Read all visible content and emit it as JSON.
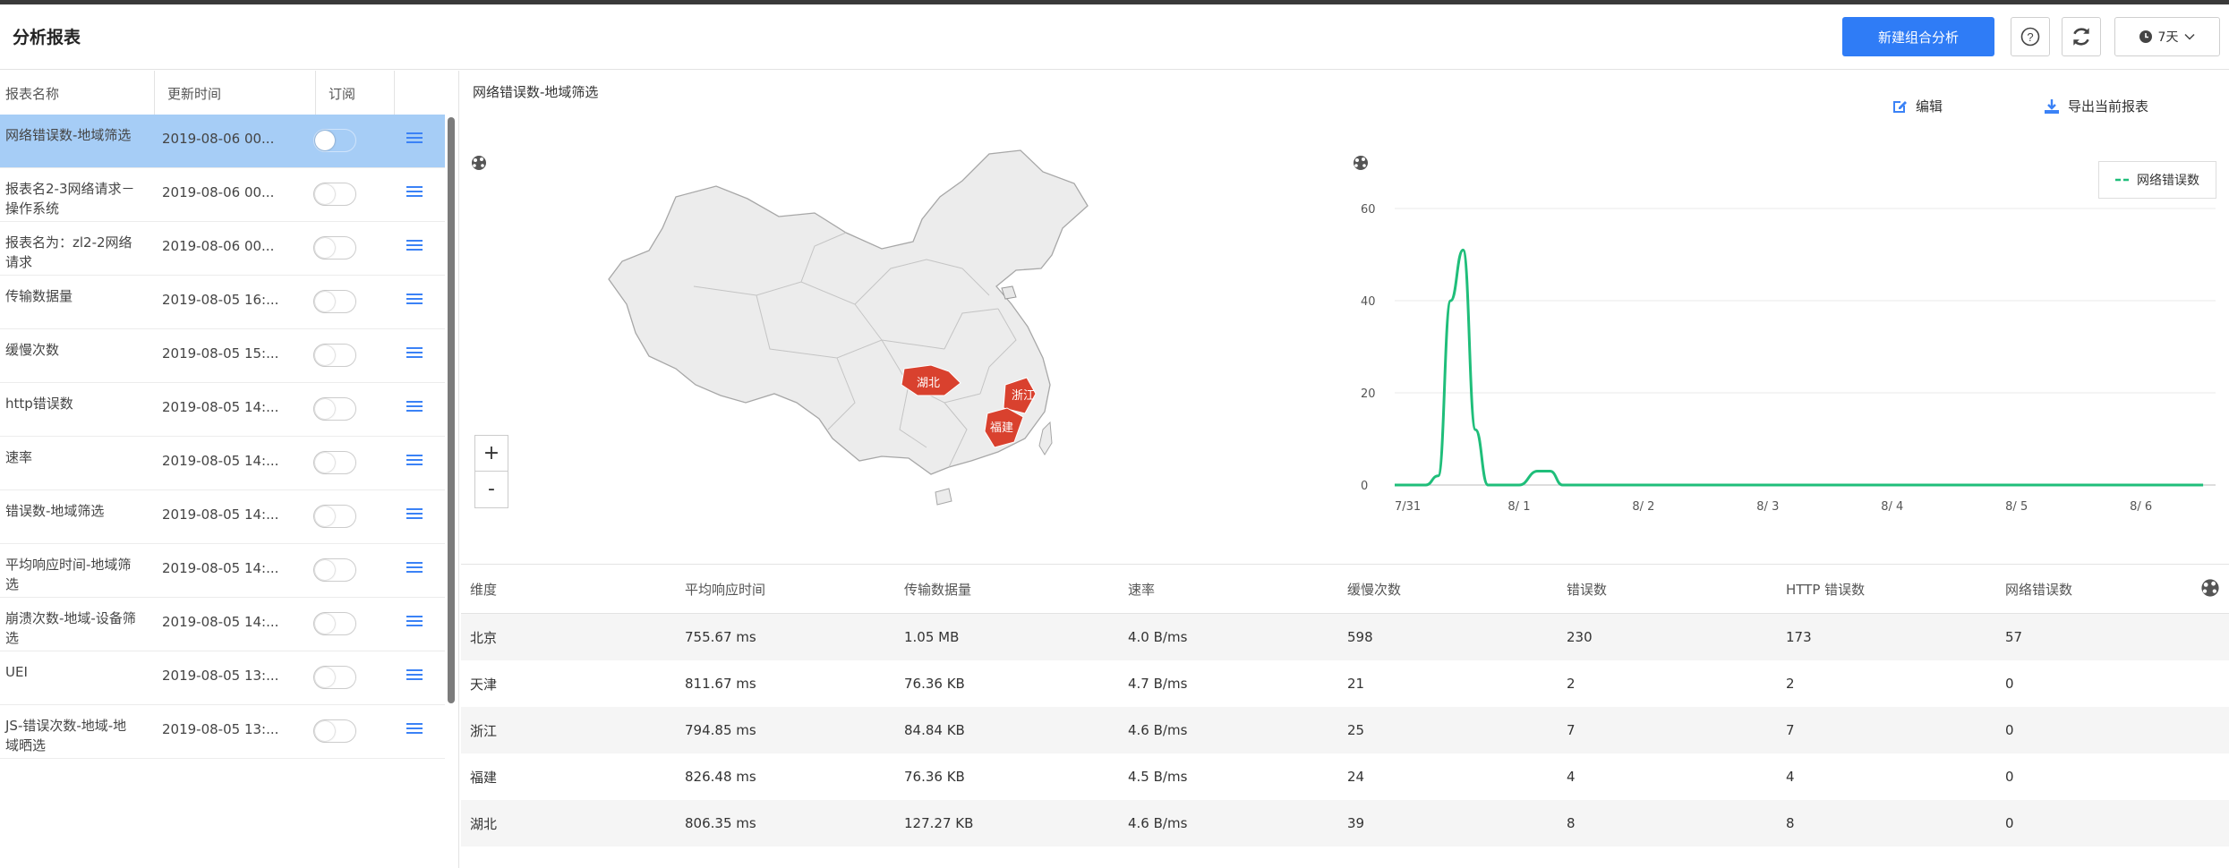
{
  "header": {
    "title": "分析报表",
    "new_button": "新建组合分析",
    "time_range": "7天"
  },
  "report_list": {
    "columns": {
      "name": "报表名称",
      "time": "更新时间",
      "subscribe": "订阅"
    },
    "rows": [
      {
        "name": "网络错误数-地域筛选",
        "time": "2019-08-06 00...",
        "subscribed": false,
        "selected": true
      },
      {
        "name": "报表名2-3网络请求－操作系统",
        "time": "2019-08-06 00...",
        "subscribed": false
      },
      {
        "name": "报表名为：zl2-2网络请求",
        "time": "2019-08-06 00...",
        "subscribed": false
      },
      {
        "name": "传输数据量",
        "time": "2019-08-05 16:...",
        "subscribed": false
      },
      {
        "name": "缓慢次数",
        "time": "2019-08-05 15:...",
        "subscribed": false
      },
      {
        "name": "http错误数",
        "time": "2019-08-05 14:...",
        "subscribed": false
      },
      {
        "name": "速率",
        "time": "2019-08-05 14:...",
        "subscribed": false
      },
      {
        "name": "错误数-地域筛选",
        "time": "2019-08-05 14:...",
        "subscribed": false
      },
      {
        "name": "平均响应时间-地域筛选",
        "time": "2019-08-05 14:...",
        "subscribed": false
      },
      {
        "name": "崩溃次数-地域-设备筛选",
        "time": "2019-08-05 14:...",
        "subscribed": false
      },
      {
        "name": "UEI",
        "time": "2019-08-05 13:...",
        "subscribed": false
      },
      {
        "name": "JS-错误次数-地域-地域晒选",
        "time": "2019-08-05 13:...",
        "subscribed": false
      }
    ]
  },
  "report": {
    "title": "网络错误数-地域筛选",
    "edit_label": "编辑",
    "export_label": "导出当前报表",
    "map_regions": [
      {
        "name": "湖北",
        "color": "#d9412e"
      },
      {
        "name": "浙江",
        "color": "#d9412e"
      },
      {
        "name": "福建",
        "color": "#d9412e"
      }
    ],
    "zoom_in": "+",
    "zoom_out": "-"
  },
  "chart_data": {
    "type": "line",
    "x_ticks": [
      "7/31",
      "8/ 1",
      "8/ 2",
      "8/ 3",
      "8/ 4",
      "8/ 5",
      "8/ 6"
    ],
    "ylim": [
      0,
      60
    ],
    "y_ticks": [
      "0",
      "20",
      "40",
      "60"
    ],
    "series": [
      {
        "name": "网络错误数",
        "color": "#1fbe7a",
        "x": [
          0,
          0.25,
          0.35,
          0.45,
          0.55,
          0.65,
          0.75,
          1.0,
          1.15,
          1.25,
          1.35,
          2,
          3,
          4,
          5,
          6,
          6.5
        ],
        "values": [
          0,
          0,
          2,
          40,
          51,
          12,
          0,
          0,
          3,
          3,
          0,
          0,
          0,
          0,
          0,
          0,
          0
        ]
      }
    ],
    "legend": "top-right",
    "grid": true
  },
  "table": {
    "headers": [
      "维度",
      "平均响应时间",
      "传输数据量",
      "速率",
      "缓慢次数",
      "错误数",
      "HTTP 错误数",
      "网络错误数"
    ],
    "rows": [
      [
        "北京",
        "755.67 ms",
        "1.05 MB",
        "4.0 B/ms",
        "598",
        "230",
        "173",
        "57"
      ],
      [
        "天津",
        "811.67 ms",
        "76.36 KB",
        "4.7 B/ms",
        "21",
        "2",
        "2",
        "0"
      ],
      [
        "浙江",
        "794.85 ms",
        "84.84 KB",
        "4.6 B/ms",
        "25",
        "7",
        "7",
        "0"
      ],
      [
        "福建",
        "826.48 ms",
        "76.36 KB",
        "4.5 B/ms",
        "24",
        "4",
        "4",
        "0"
      ],
      [
        "湖北",
        "806.35 ms",
        "127.27 KB",
        "4.6 B/ms",
        "39",
        "8",
        "8",
        "0"
      ]
    ]
  }
}
